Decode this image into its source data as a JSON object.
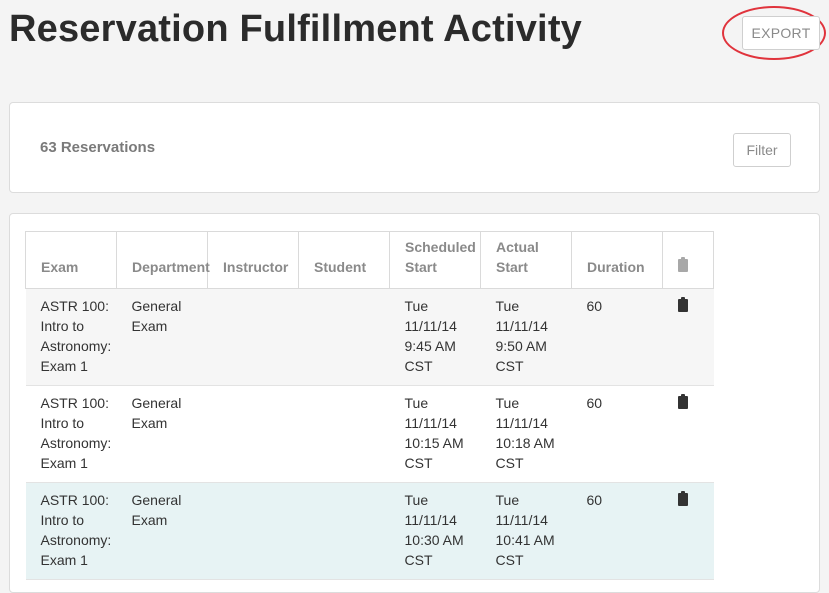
{
  "header": {
    "title": "Reservation Fulfillment Activity",
    "export_label": "EXPORT"
  },
  "summary": {
    "count_label": "63 Reservations",
    "filter_label": "Filter"
  },
  "table": {
    "columns": [
      "Exam",
      "Department",
      "Instructor",
      "Student",
      "Scheduled Start",
      "Actual Start",
      "Duration",
      "clipboard-icon"
    ],
    "rows": [
      {
        "exam": "ASTR 100: Intro to Astronomy: Exam 1",
        "department": "General Exam",
        "instructor": "",
        "student": "",
        "scheduled_start": "Tue 11/11/14 9:45 AM CST",
        "actual_start": "Tue 11/11/14 9:50 AM CST",
        "duration": "60"
      },
      {
        "exam": "ASTR 100: Intro to Astronomy: Exam 1",
        "department": "General Exam",
        "instructor": "",
        "student": "",
        "scheduled_start": "Tue 11/11/14 10:15 AM CST",
        "actual_start": "Tue 11/11/14 10:18 AM CST",
        "duration": "60"
      },
      {
        "exam": "ASTR 100: Intro to Astronomy: Exam 1",
        "department": "General Exam",
        "instructor": "",
        "student": "",
        "scheduled_start": "Tue 11/11/14 10:30 AM CST",
        "actual_start": "Tue 11/11/14 10:41 AM CST",
        "duration": "60"
      }
    ]
  },
  "colors": {
    "highlight_ring": "#e0333c",
    "selected_row": "#e7f3f4"
  }
}
